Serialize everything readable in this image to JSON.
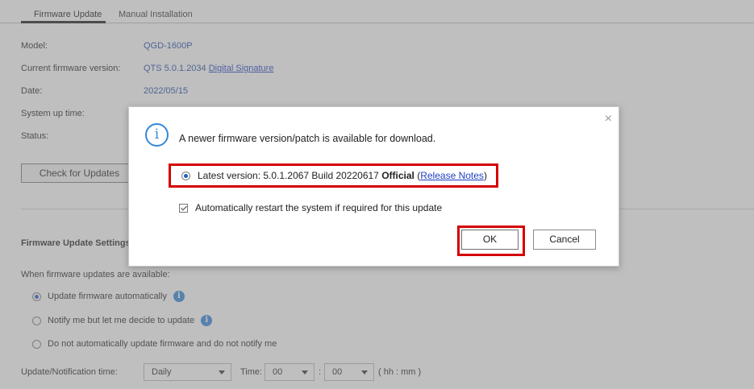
{
  "tabs": [
    {
      "label": "Firmware Update",
      "active": true
    },
    {
      "label": "Manual Installation",
      "active": false
    }
  ],
  "info": {
    "model_label": "Model:",
    "model_value": "QGD-1600P",
    "firmware_label": "Current firmware version:",
    "firmware_value": "QTS 5.0.1.2034",
    "firmware_link": "Digital Signature",
    "date_label": "Date:",
    "date_value": "2022/05/15",
    "uptime_label": "System up time:",
    "status_label": "Status:"
  },
  "check_button": "Check for Updates",
  "settings": {
    "title": "Firmware Update Settings",
    "when_label": "When firmware updates are available:",
    "options": [
      {
        "label": "Update firmware automatically",
        "checked": true,
        "info": true
      },
      {
        "label": "Notify me but let me decide to update",
        "checked": false,
        "info": true
      },
      {
        "label": "Do not automatically update firmware and do not notify me",
        "checked": false,
        "info": false
      }
    ],
    "time_label": "Update/Notification time:",
    "frequency": "Daily",
    "time_word": "Time:",
    "hour": "00",
    "separator": ":",
    "minute": "00",
    "format_hint": "( hh : mm )"
  },
  "dialog": {
    "close_glyph": "×",
    "info_glyph": "i",
    "message": "A newer firmware version/patch is available for download.",
    "latest_prefix": "Latest version: 5.0.1.2067 Build 20220617",
    "latest_bold": "Official",
    "latest_open": "(",
    "latest_link": "Release Notes",
    "latest_close": ")",
    "auto_restart": "Automatically restart the system if required for this update",
    "ok": "OK",
    "cancel": "Cancel"
  },
  "colors": {
    "accent": "#2f84d6",
    "highlight": "#d40000",
    "link": "#1c3fc2"
  }
}
